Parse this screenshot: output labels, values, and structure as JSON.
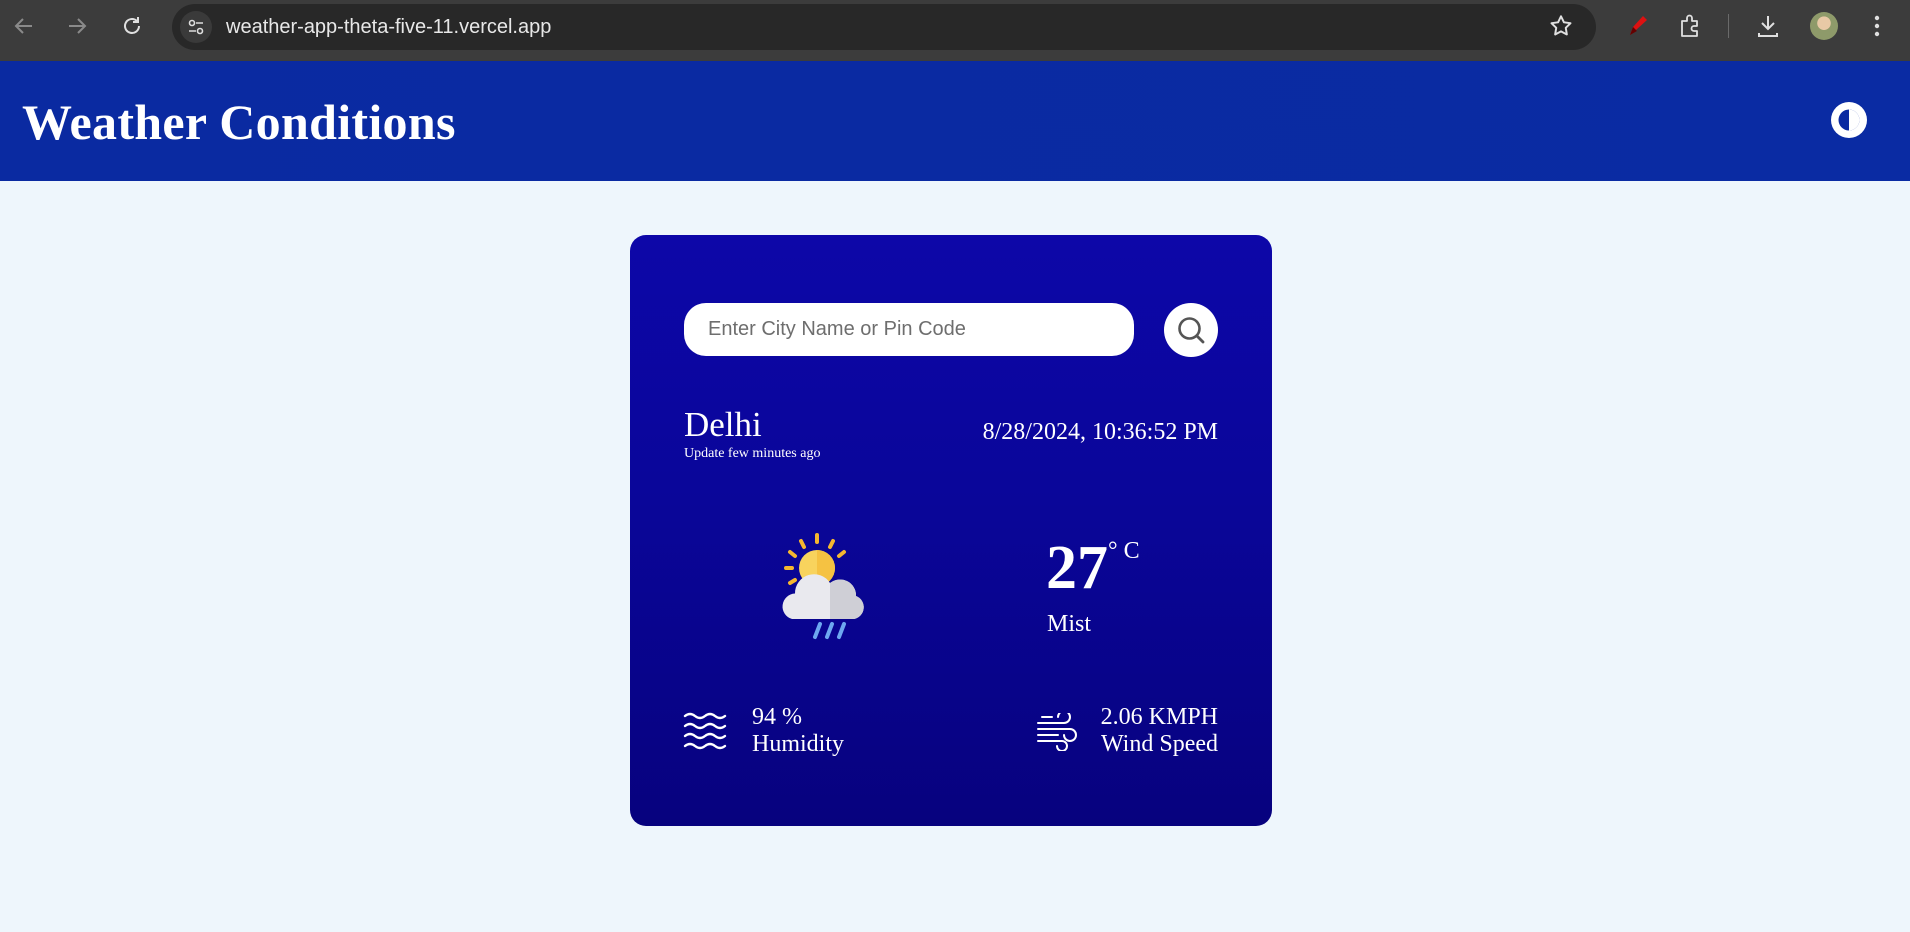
{
  "browser": {
    "url": "weather-app-theta-five-11.vercel.app",
    "icons": [
      "back-icon",
      "forward-icon",
      "reload-icon",
      "site-info-icon",
      "bookmark-star-icon",
      "extension-pen-icon",
      "extensions-puzzle-icon",
      "download-icon",
      "profile-avatar",
      "more-menu-icon"
    ]
  },
  "header": {
    "title": "Weather Conditions",
    "toggle_icon": "theme-toggle-icon",
    "background": "#0a2aa1"
  },
  "search": {
    "placeholder": "Enter City Name or Pin Code",
    "value": "",
    "button_icon": "search-icon"
  },
  "location": {
    "city": "Delhi",
    "updated": "Update few minutes ago",
    "datetime": "8/28/2024, 10:36:52 PM"
  },
  "current": {
    "icon": "partly-cloudy-rain-icon",
    "temperature": "27",
    "unit": "° C",
    "condition": "Mist"
  },
  "details": {
    "humidity_value": "94 %",
    "humidity_label": "Humidity",
    "humidity_icon": "humidity-waves-icon",
    "wind_value": "2.06 KMPH",
    "wind_label": "Wind Speed",
    "wind_icon": "wind-icon"
  },
  "colors": {
    "card_top": "#0d07a8",
    "card_bottom": "#07027e",
    "page_background": "#eef6fc"
  }
}
